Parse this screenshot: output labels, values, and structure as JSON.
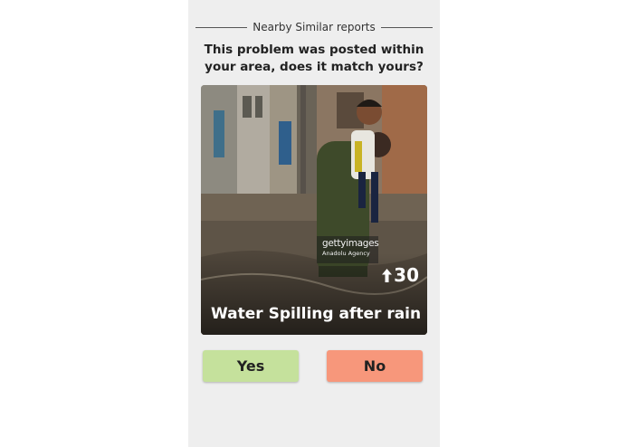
{
  "header": {
    "title": "Nearby Similar reports"
  },
  "question": {
    "text": "This problem was posted within your area, does it match yours?"
  },
  "report": {
    "title": "Water Spilling after rain",
    "upvotes": "30",
    "upvote_icon": "arrow-up-icon",
    "watermark": {
      "brand": "gettyimages",
      "credit": "Anadolu Agency"
    }
  },
  "actions": {
    "yes_label": "Yes",
    "no_label": "No"
  },
  "colors": {
    "screen_background": "#eeeeee",
    "yes_button": "#c5e19c",
    "no_button": "#f7977b"
  }
}
